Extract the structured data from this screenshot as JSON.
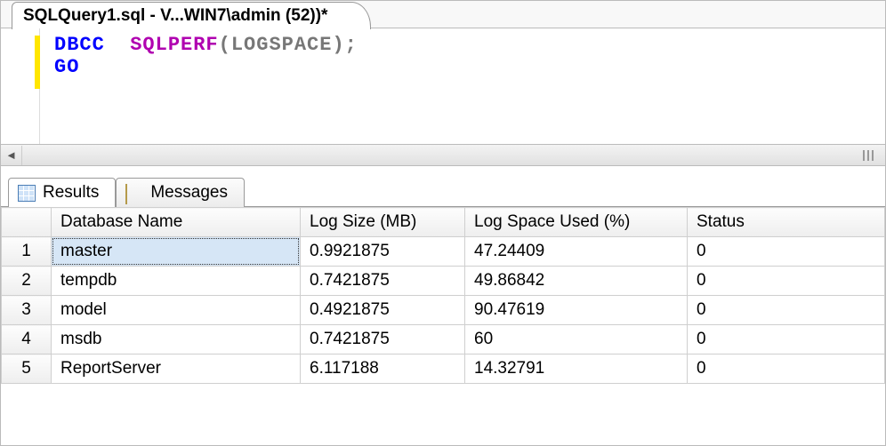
{
  "tab": {
    "title": "SQLQuery1.sql - V...WIN7\\admin (52))*"
  },
  "code": {
    "line1": {
      "kw": "DBCC",
      "sp1": "  ",
      "fn": "SQLPERF",
      "args": "(LOGSPACE)",
      "semi": ";"
    },
    "line2": {
      "kw": "GO"
    }
  },
  "results": {
    "tabs": {
      "results": "Results",
      "messages": "Messages"
    },
    "columns": {
      "db": "Database Name",
      "log": "Log Size (MB)",
      "used": "Log Space Used (%)",
      "status": "Status"
    },
    "rows": [
      {
        "n": "1",
        "db": "master",
        "log": "0.9921875",
        "used": "47.24409",
        "status": "0"
      },
      {
        "n": "2",
        "db": "tempdb",
        "log": "0.7421875",
        "used": "49.86842",
        "status": "0"
      },
      {
        "n": "3",
        "db": "model",
        "log": "0.4921875",
        "used": "90.47619",
        "status": "0"
      },
      {
        "n": "4",
        "db": "msdb",
        "log": "0.7421875",
        "used": "60",
        "status": "0"
      },
      {
        "n": "5",
        "db": "ReportServer",
        "log": "6.117188",
        "used": "14.32791",
        "status": "0"
      }
    ]
  }
}
